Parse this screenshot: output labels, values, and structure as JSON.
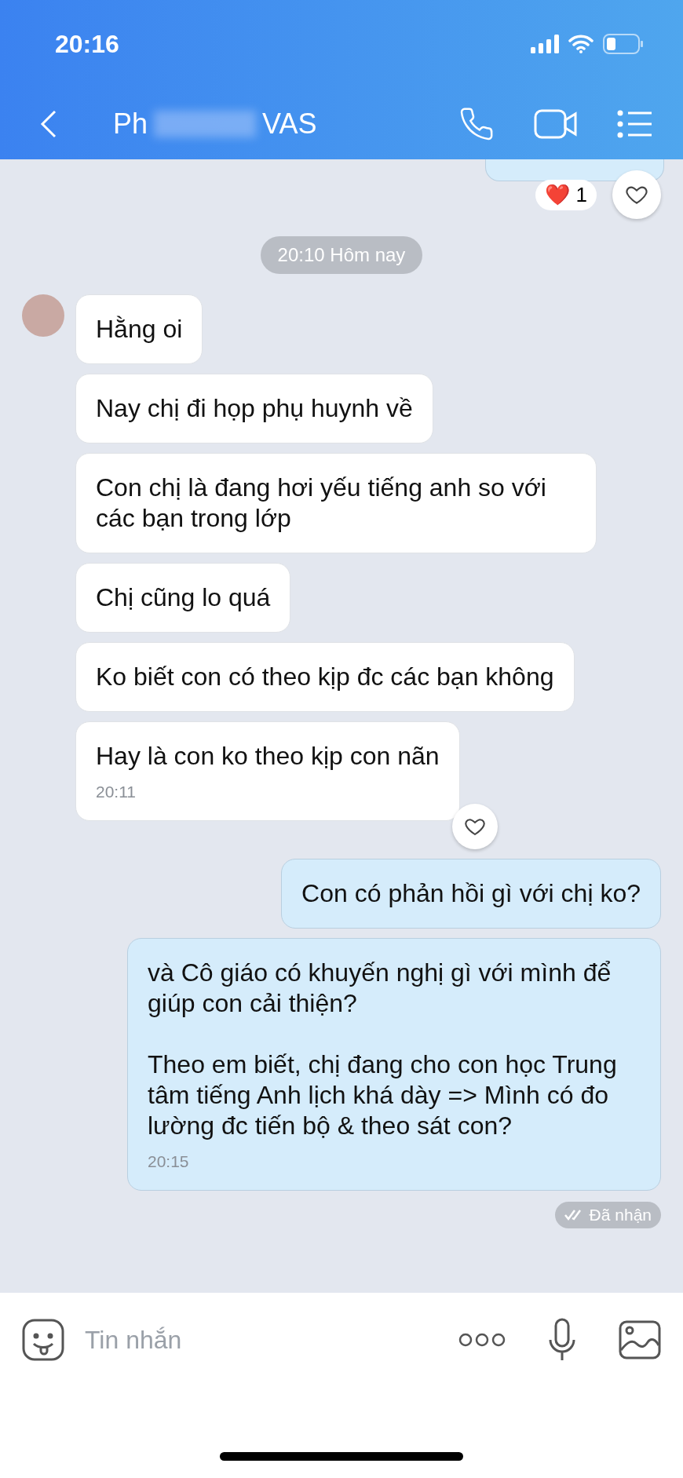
{
  "status_bar": {
    "time": "20:16"
  },
  "header": {
    "title_start": "Ph",
    "title_end": "VAS",
    "name_blurred": true
  },
  "previous_reaction": {
    "emoji": "❤️",
    "count": "1"
  },
  "date_separator": "20:10 Hôm nay",
  "messages": [
    {
      "kind": "incoming",
      "text": "Hằng oi",
      "avatar": true
    },
    {
      "kind": "incoming",
      "text": "Nay chị đi họp phụ huynh về"
    },
    {
      "kind": "incoming",
      "text": "Con chị là đang hơi yếu tiếng anh so với các bạn trong lớp"
    },
    {
      "kind": "incoming",
      "text": "Chị cũng lo quá"
    },
    {
      "kind": "incoming",
      "text": "Ko biết con có theo kịp đc các bạn không"
    },
    {
      "kind": "incoming",
      "text": "Hay là con ko theo kịp con nãn",
      "time": "20:11",
      "react_button": true
    },
    {
      "kind": "outgoing",
      "text": "Con có phản hồi gì với chị ko?"
    },
    {
      "kind": "outgoing",
      "text": "và Cô giáo có khuyến nghị gì với mình để giúp con cải thiện?\n\nTheo em biết, chị đang cho con học Trung tâm tiếng Anh lịch khá dày => Mình có đo lường đc tiến bộ & theo sát con?",
      "time": "20:15"
    }
  ],
  "delivery_status": "Đã nhận",
  "composer": {
    "placeholder": "Tin nhắn"
  }
}
